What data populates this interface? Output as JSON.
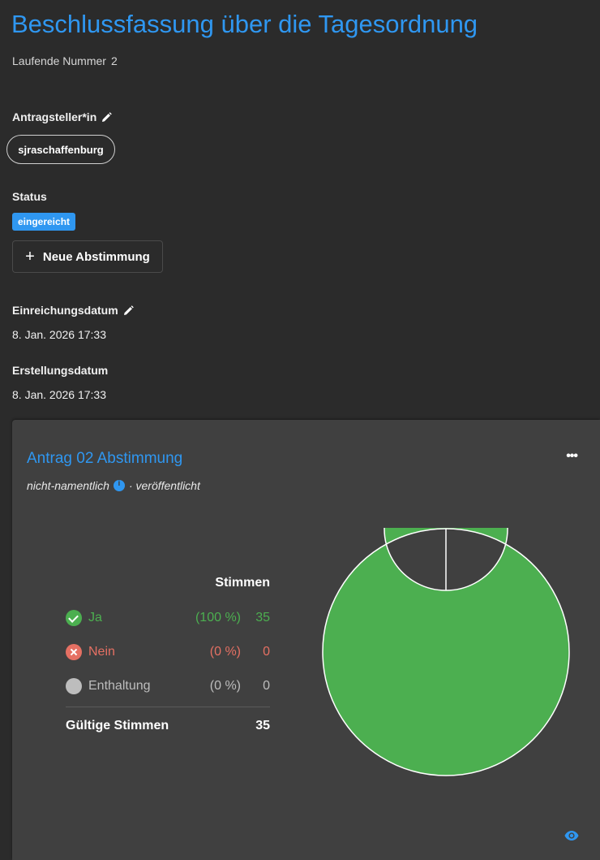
{
  "header": {
    "title": "Beschlussfassung über die Tagesordnung",
    "number_label": "Laufende Nummer",
    "number_value": "2"
  },
  "applicant": {
    "label": "Antragsteller*in",
    "name": "sjraschaffenburg"
  },
  "status": {
    "label": "Status",
    "value": "eingereicht"
  },
  "new_vote_button": {
    "label": "Neue Abstimmung"
  },
  "submission_date": {
    "label": "Einreichungsdatum",
    "value": "8. Jan. 2026 17:33"
  },
  "creation_date": {
    "label": "Erstellungsdatum",
    "value": "8. Jan. 2026 17:33"
  },
  "poll": {
    "title": "Antrag 02 Abstimmung",
    "type": "nicht-namentlich",
    "state": "· veröffentlicht",
    "votes_header": "Stimmen",
    "options": [
      {
        "name": "Ja",
        "percent": "(100 %)",
        "count": "35"
      },
      {
        "name": "Nein",
        "percent": "(0 %)",
        "count": "0"
      },
      {
        "name": "Enthaltung",
        "percent": "(0 %)",
        "count": "0"
      }
    ],
    "valid_label": "Gültige Stimmen",
    "valid_count": "35"
  },
  "chart_data": {
    "type": "pie",
    "categories": [
      "Ja",
      "Nein",
      "Enthaltung"
    ],
    "values": [
      35,
      0,
      0
    ],
    "colors": [
      "#4caf50",
      "#e57063",
      "#bdbdbd"
    ]
  }
}
